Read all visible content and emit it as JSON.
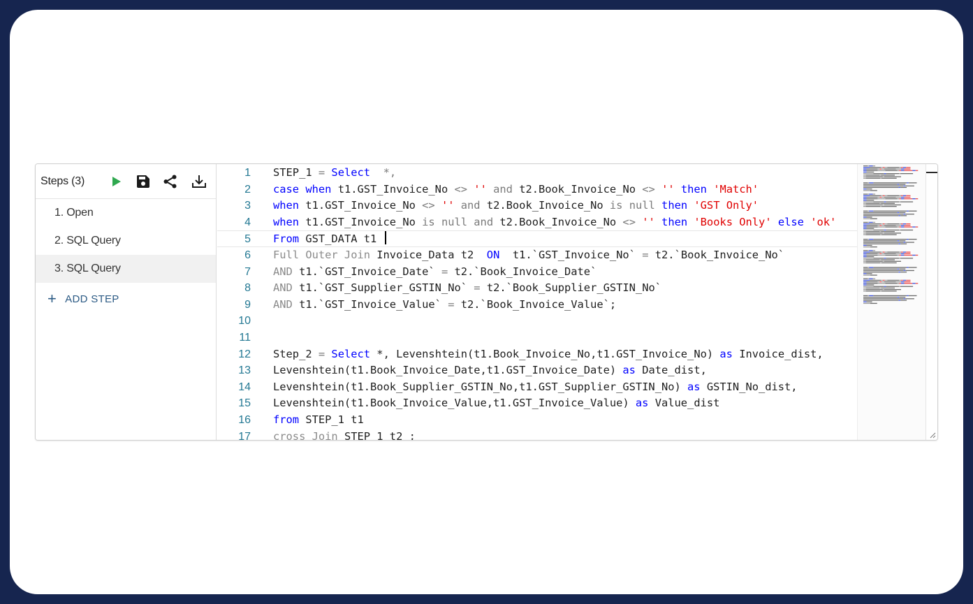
{
  "sidebar": {
    "title": "Steps (3)",
    "steps": [
      {
        "label": "1. Open"
      },
      {
        "label": "2. SQL Query"
      },
      {
        "label": "3. SQL Query"
      }
    ],
    "active_step_index": 2,
    "add_step_label": "ADD STEP",
    "toolbar": {
      "run_icon": "play-icon",
      "save_icon": "save-icon",
      "share_icon": "share-icon",
      "download_icon": "download-icon"
    }
  },
  "colors": {
    "frame_background": "#16254f",
    "run_icon": "#2fa84f",
    "add_step": "#2b5a84",
    "keyword": "#0000ff",
    "string": "#e00000",
    "line_number": "#237893"
  },
  "editor": {
    "current_line": 5,
    "lines": [
      {
        "n": "1",
        "tokens": [
          [
            "STEP_1 ",
            ""
          ],
          [
            "= ",
            "op"
          ],
          [
            "Select",
            "kw"
          ],
          [
            "  *,",
            "op"
          ]
        ]
      },
      {
        "n": "2",
        "tokens": [
          [
            "case ",
            "kw"
          ],
          [
            "when ",
            "kw"
          ],
          [
            "t1.GST_Invoice_No ",
            ""
          ],
          [
            "<> ",
            "op"
          ],
          [
            "'' ",
            "str"
          ],
          [
            "and ",
            "op"
          ],
          [
            "t2.Book_Invoice_No ",
            ""
          ],
          [
            "<> ",
            "op"
          ],
          [
            "'' ",
            "str"
          ],
          [
            "then ",
            "kw"
          ],
          [
            "'Match'",
            "str"
          ]
        ]
      },
      {
        "n": "3",
        "tokens": [
          [
            "when ",
            "kw"
          ],
          [
            "t1.GST_Invoice_No ",
            ""
          ],
          [
            "<> ",
            "op"
          ],
          [
            "'' ",
            "str"
          ],
          [
            "and ",
            "op"
          ],
          [
            "t2.Book_Invoice_No ",
            ""
          ],
          [
            "is null ",
            "op"
          ],
          [
            "then ",
            "kw"
          ],
          [
            "'GST Only'",
            "str"
          ]
        ]
      },
      {
        "n": "4",
        "tokens": [
          [
            "when ",
            "kw"
          ],
          [
            "t1.GST_Invoice_No ",
            ""
          ],
          [
            "is null ",
            "op"
          ],
          [
            "and ",
            "op"
          ],
          [
            "t2.Book_Invoice_No ",
            ""
          ],
          [
            "<> ",
            "op"
          ],
          [
            "'' ",
            "str"
          ],
          [
            "then ",
            "kw"
          ],
          [
            "'Books Only' ",
            "str"
          ],
          [
            "else ",
            "kw"
          ],
          [
            "'ok'",
            "str"
          ]
        ]
      },
      {
        "n": "5",
        "tokens": [
          [
            "From ",
            "kw"
          ],
          [
            "GST_DATA t1 ",
            ""
          ]
        ]
      },
      {
        "n": "6",
        "tokens": [
          [
            "Full Outer Join ",
            "gray"
          ],
          [
            "Invoice_Data t2  ",
            ""
          ],
          [
            "ON ",
            "kw"
          ],
          [
            " t1.`GST_Invoice_No` ",
            ""
          ],
          [
            "= ",
            "op"
          ],
          [
            "t2.`Book_Invoice_No`",
            ""
          ]
        ]
      },
      {
        "n": "7",
        "tokens": [
          [
            "AND ",
            "gray"
          ],
          [
            "t1.`GST_Invoice_Date` ",
            ""
          ],
          [
            "= ",
            "op"
          ],
          [
            "t2.`Book_Invoice_Date`",
            ""
          ]
        ]
      },
      {
        "n": "8",
        "tokens": [
          [
            "AND ",
            "gray"
          ],
          [
            "t1.`GST_Supplier_GSTIN_No` ",
            ""
          ],
          [
            "= ",
            "op"
          ],
          [
            "t2.`Book_Supplier_GSTIN_No`",
            ""
          ]
        ]
      },
      {
        "n": "9",
        "tokens": [
          [
            "AND ",
            "gray"
          ],
          [
            "t1.`GST_Invoice_Value` ",
            ""
          ],
          [
            "= ",
            "op"
          ],
          [
            "t2.`Book_Invoice_Value`;",
            ""
          ]
        ]
      },
      {
        "n": "10",
        "tokens": []
      },
      {
        "n": "11",
        "tokens": []
      },
      {
        "n": "12",
        "tokens": [
          [
            "Step_2 ",
            ""
          ],
          [
            "= ",
            "op"
          ],
          [
            "Select ",
            "kw"
          ],
          [
            "*, Levenshtein(t1.Book_Invoice_No,t1.GST_Invoice_No) ",
            ""
          ],
          [
            "as ",
            "kw"
          ],
          [
            "Invoice_dist,",
            ""
          ]
        ]
      },
      {
        "n": "13",
        "tokens": [
          [
            "Levenshtein(t1.Book_Invoice_Date,t1.GST_Invoice_Date) ",
            ""
          ],
          [
            "as ",
            "kw"
          ],
          [
            "Date_dist,",
            ""
          ]
        ]
      },
      {
        "n": "14",
        "tokens": [
          [
            "Levenshtein(t1.Book_Supplier_GSTIN_No,t1.GST_Supplier_GSTIN_No) ",
            ""
          ],
          [
            "as ",
            "kw"
          ],
          [
            "GSTIN_No_dist,",
            ""
          ]
        ]
      },
      {
        "n": "15",
        "tokens": [
          [
            "Levenshtein(t1.Book_Invoice_Value,t1.GST_Invoice_Value) ",
            ""
          ],
          [
            "as ",
            "kw"
          ],
          [
            "Value_dist",
            ""
          ]
        ]
      },
      {
        "n": "16",
        "tokens": [
          [
            "from ",
            "kw"
          ],
          [
            "STEP_1 t1",
            ""
          ]
        ]
      },
      {
        "n": "17",
        "tokens": [
          [
            "cross Join ",
            "gray"
          ],
          [
            "STEP_1 t2 ;",
            ""
          ]
        ]
      }
    ]
  }
}
